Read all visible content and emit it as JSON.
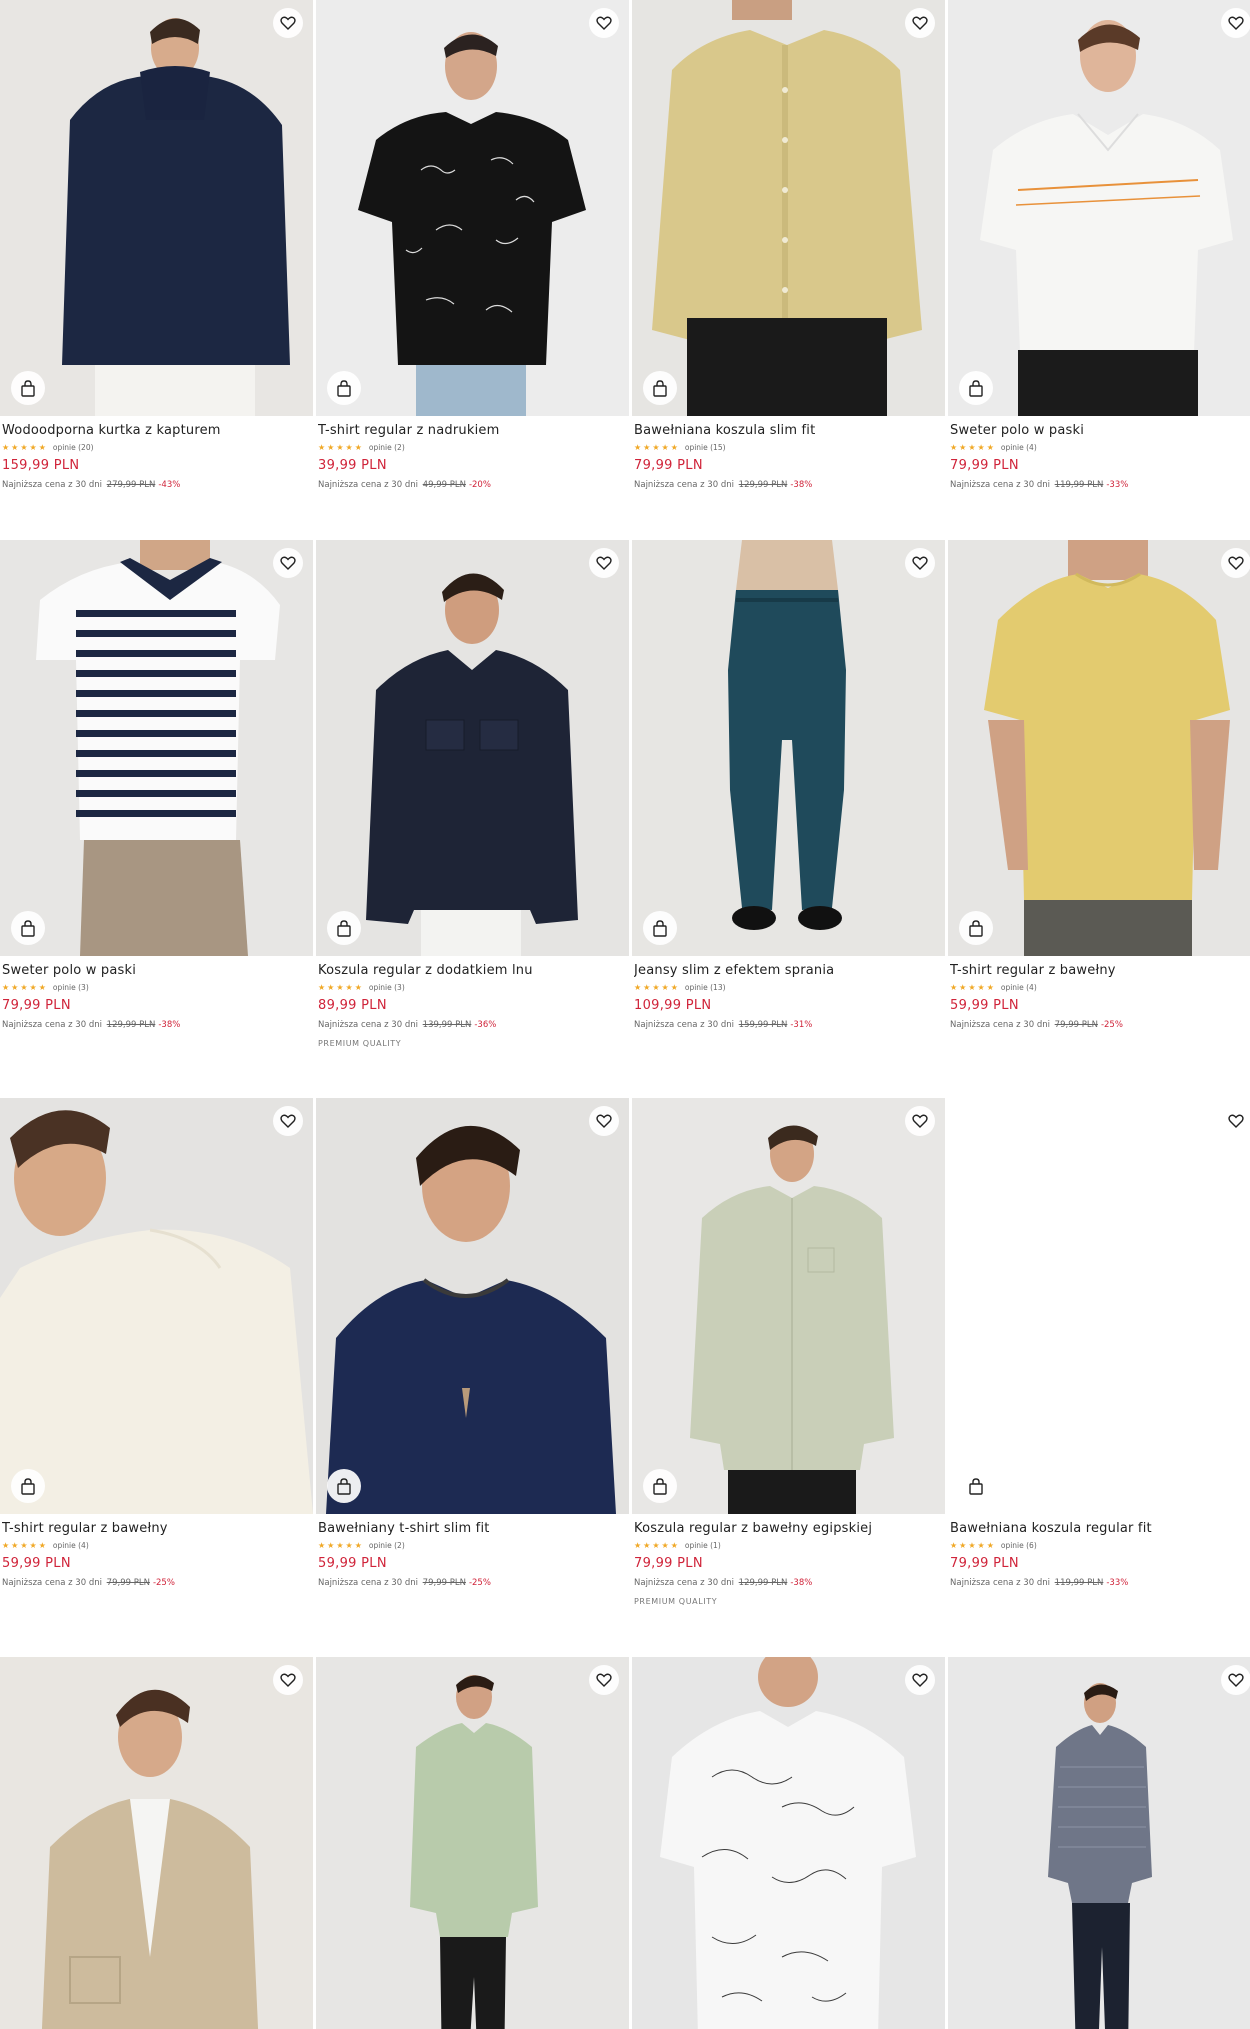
{
  "icons": {
    "favorite": "heart-icon",
    "add_to_cart": "shopping-bag-icon",
    "rating": "star-icon"
  },
  "colors": {
    "price": "#d0243a",
    "star": "#f0a826",
    "discount": "#d0243a"
  },
  "products": [
    {
      "name": "Wodoodporna kurtka z kapturem",
      "stars": "★★★★★",
      "reviews": "opinie (20)",
      "price": "159,99 PLN",
      "lowest_label": "Najniższa cena z 30 dni",
      "old_price": "279,99 PLN",
      "discount": "-43%",
      "badge": ""
    },
    {
      "name": "T-shirt regular z nadrukiem",
      "stars": "★★★★★",
      "reviews": "opinie (2)",
      "price": "39,99 PLN",
      "lowest_label": "Najniższa cena z 30 dni",
      "old_price": "49,99 PLN",
      "discount": "-20%",
      "badge": ""
    },
    {
      "name": "Bawełniana koszula slim fit",
      "stars": "★★★★★",
      "reviews": "opinie (15)",
      "price": "79,99 PLN",
      "lowest_label": "Najniższa cena z 30 dni",
      "old_price": "129,99 PLN",
      "discount": "-38%",
      "badge": ""
    },
    {
      "name": "Sweter polo w paski",
      "stars": "★★★★★",
      "reviews": "opinie (4)",
      "price": "79,99 PLN",
      "lowest_label": "Najniższa cena z 30 dni",
      "old_price": "119,99 PLN",
      "discount": "-33%",
      "badge": ""
    },
    {
      "name": "Sweter polo w paski",
      "stars": "★★★★★",
      "reviews": "opinie (3)",
      "price": "79,99 PLN",
      "lowest_label": "Najniższa cena z 30 dni",
      "old_price": "129,99 PLN",
      "discount": "-38%",
      "badge": ""
    },
    {
      "name": "Koszula regular z dodatkiem lnu",
      "stars": "★★★★★",
      "reviews": "opinie (3)",
      "price": "89,99 PLN",
      "lowest_label": "Najniższa cena z 30 dni",
      "old_price": "139,99 PLN",
      "discount": "-36%",
      "badge": "PREMIUM QUALITY"
    },
    {
      "name": "Jeansy slim z efektem sprania",
      "stars": "★★★★★",
      "reviews": "opinie (13)",
      "price": "109,99 PLN",
      "lowest_label": "Najniższa cena z 30 dni",
      "old_price": "159,99 PLN",
      "discount": "-31%",
      "badge": ""
    },
    {
      "name": "T-shirt regular z bawełny",
      "stars": "★★★★★",
      "reviews": "opinie (4)",
      "price": "59,99 PLN",
      "lowest_label": "Najniższa cena z 30 dni",
      "old_price": "79,99 PLN",
      "discount": "-25%",
      "badge": ""
    },
    {
      "name": "T-shirt regular z bawełny",
      "stars": "★★★★★",
      "reviews": "opinie (4)",
      "price": "59,99 PLN",
      "lowest_label": "Najniższa cena z 30 dni",
      "old_price": "79,99 PLN",
      "discount": "-25%",
      "badge": ""
    },
    {
      "name": "Bawełniany t-shirt slim fit",
      "stars": "★★★★★",
      "reviews": "opinie (2)",
      "price": "59,99 PLN",
      "lowest_label": "Najniższa cena z 30 dni",
      "old_price": "79,99 PLN",
      "discount": "-25%",
      "badge": ""
    },
    {
      "name": "Koszula regular z bawełny egipskiej",
      "stars": "★★★★★",
      "reviews": "opinie (1)",
      "price": "79,99 PLN",
      "lowest_label": "Najniższa cena z 30 dni",
      "old_price": "129,99 PLN",
      "discount": "-38%",
      "badge": "PREMIUM QUALITY"
    },
    {
      "name": "Bawełniana koszula regular fit",
      "stars": "★★★★★",
      "reviews": "opinie (6)",
      "price": "79,99 PLN",
      "lowest_label": "Najniższa cena z 30 dni",
      "old_price": "119,99 PLN",
      "discount": "-33%",
      "badge": ""
    },
    {
      "name": "",
      "stars": "",
      "reviews": "",
      "price": "",
      "lowest_label": "",
      "old_price": "",
      "discount": "",
      "badge": ""
    },
    {
      "name": "",
      "stars": "",
      "reviews": "",
      "price": "",
      "lowest_label": "",
      "old_price": "",
      "discount": "",
      "badge": ""
    },
    {
      "name": "",
      "stars": "",
      "reviews": "",
      "price": "",
      "lowest_label": "",
      "old_price": "",
      "discount": "",
      "badge": ""
    },
    {
      "name": "",
      "stars": "",
      "reviews": "",
      "price": "",
      "lowest_label": "",
      "old_price": "",
      "discount": "",
      "badge": ""
    }
  ]
}
